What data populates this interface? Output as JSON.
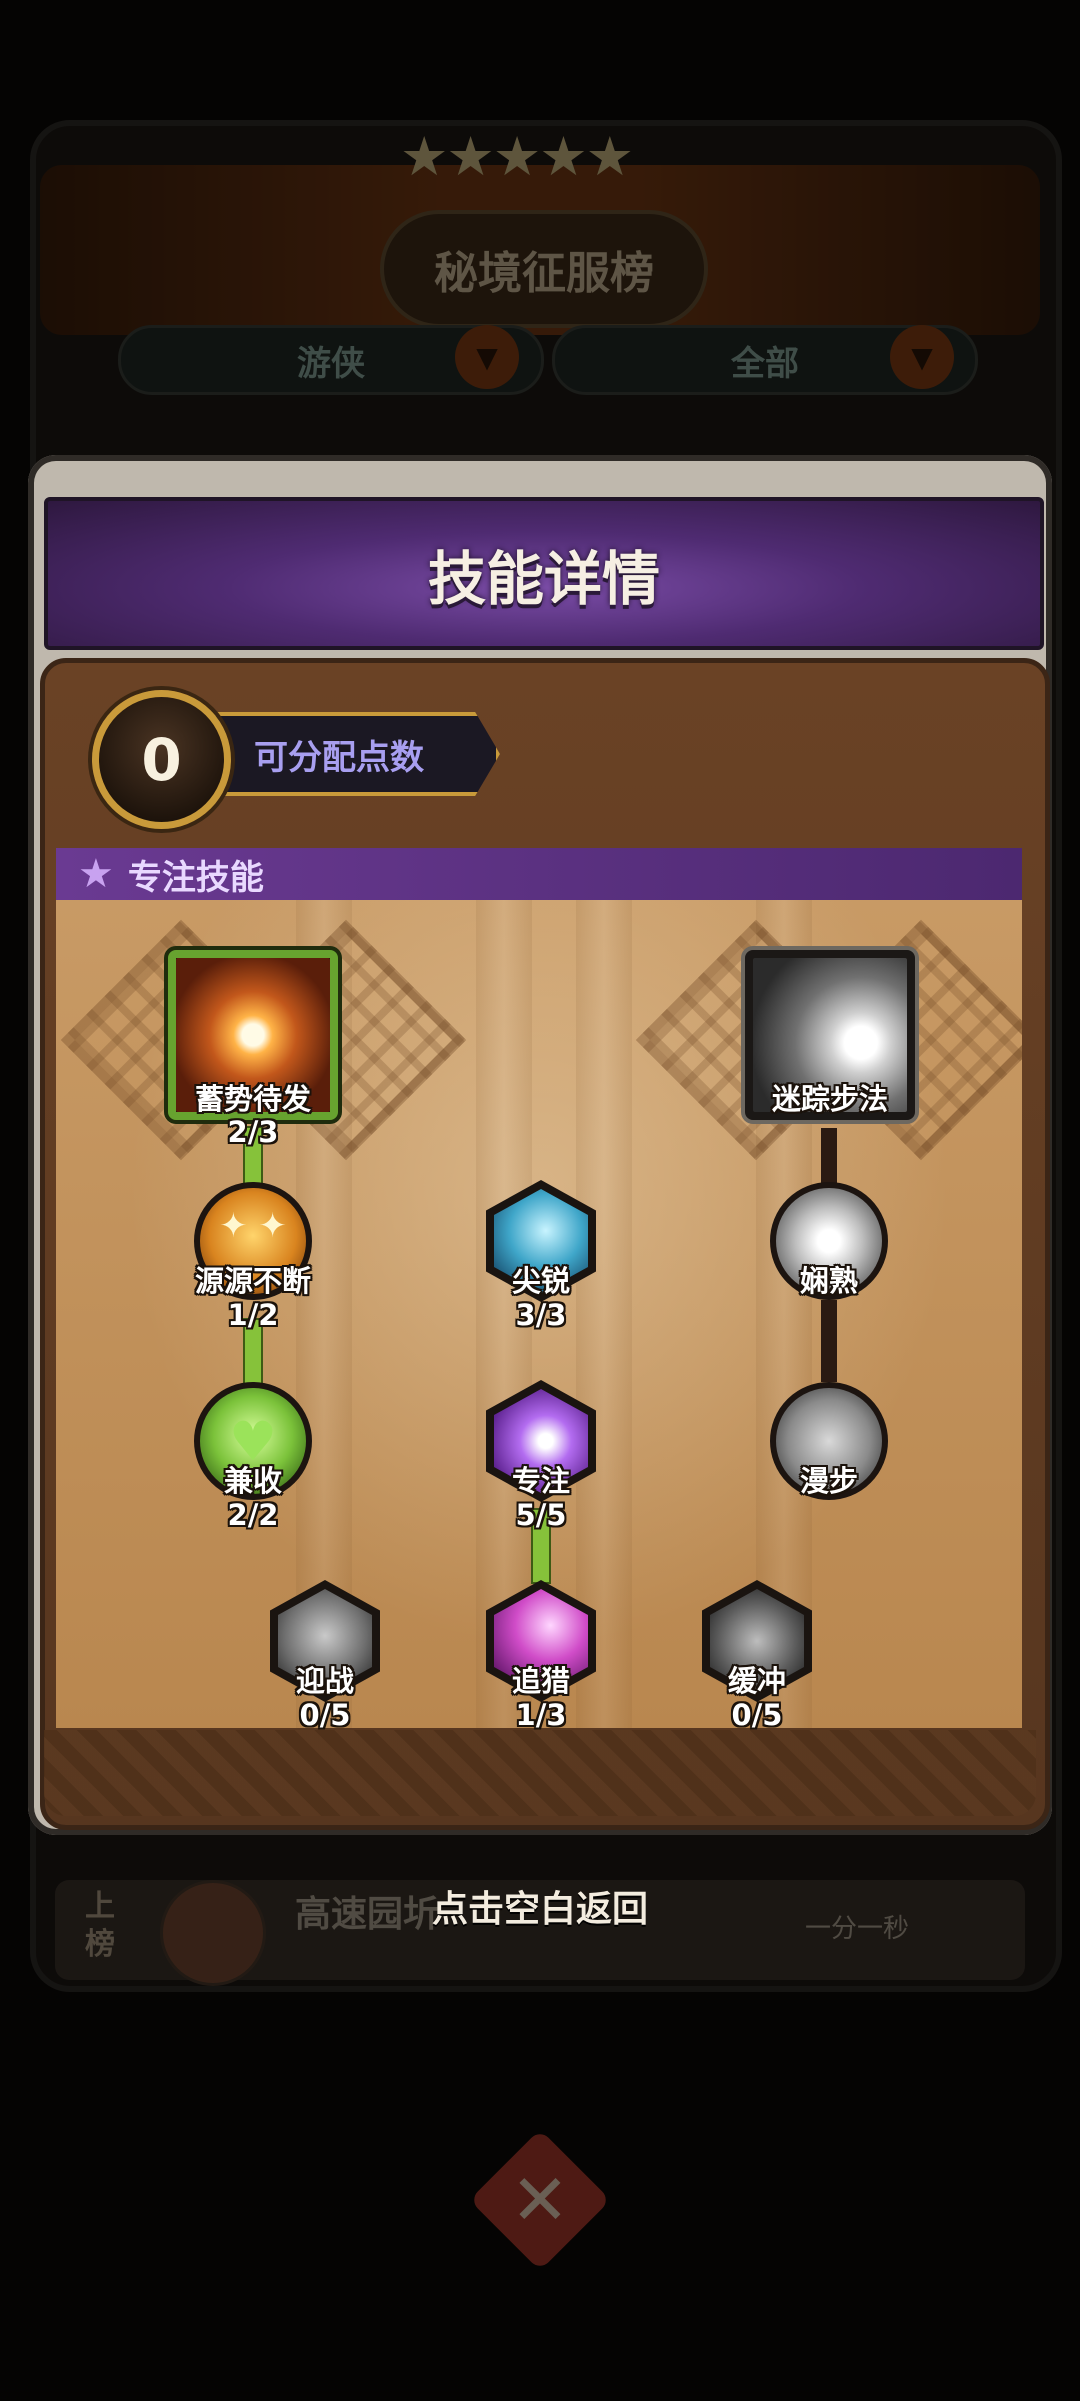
{
  "background": {
    "leaderboard_title": "秘境征服榜",
    "filter_class": "游侠",
    "filter_scope": "全部",
    "row_rank_label": "上\n榜",
    "row_name": "高速园圻",
    "row_time": "一分一秒"
  },
  "modal": {
    "title": "技能详情",
    "points": {
      "value": "0",
      "label": "可分配点数"
    },
    "section": {
      "label": "专注技能"
    },
    "nodes": [
      {
        "name": "蓄势待发",
        "level": "2/3"
      },
      {
        "name": "迷踪步法",
        "level": ""
      },
      {
        "name": "源源不断",
        "level": "1/2"
      },
      {
        "name": "尖锐",
        "level": "3/3"
      },
      {
        "name": "娴熟",
        "level": ""
      },
      {
        "name": "兼收",
        "level": "2/2"
      },
      {
        "name": "专注",
        "level": "5/5"
      },
      {
        "name": "漫步",
        "level": ""
      },
      {
        "name": "迎战",
        "level": "0/5"
      },
      {
        "name": "追猎",
        "level": "1/3"
      },
      {
        "name": "缓冲",
        "level": "0/5"
      }
    ]
  },
  "hint": {
    "return": "点击空白返回"
  },
  "colors": {
    "active_link": "#86c23a",
    "title_purple": "#4f2b72",
    "badge_gold": "#c99a3a"
  }
}
